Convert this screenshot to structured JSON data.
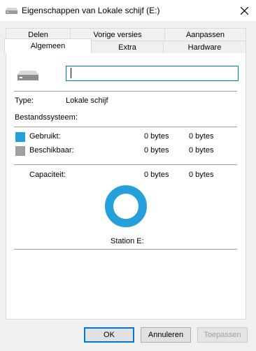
{
  "window": {
    "title": "Eigenschappen van Lokale schijf (E:)"
  },
  "tabs": {
    "row1": [
      {
        "label": "Delen",
        "name": "tab-delen"
      },
      {
        "label": "Vorige versies",
        "name": "tab-vorige-versies"
      },
      {
        "label": "Aanpassen",
        "name": "tab-aanpassen"
      }
    ],
    "row2": [
      {
        "label": "Algemeen",
        "name": "tab-algemeen",
        "active": true
      },
      {
        "label": "Extra",
        "name": "tab-extra"
      },
      {
        "label": "Hardware",
        "name": "tab-hardware"
      }
    ]
  },
  "general": {
    "name_value": "",
    "type_label": "Type:",
    "type_value": "Lokale schijf",
    "filesystem_label": "Bestandssysteem:",
    "filesystem_value": "",
    "used": {
      "label": "Gebruikt:",
      "bytes": "0 bytes",
      "size": "0 bytes",
      "color": "#26a0da"
    },
    "free": {
      "label": "Beschikbaar:",
      "bytes": "0 bytes",
      "size": "0 bytes",
      "color": "#a0a0a0"
    },
    "capacity": {
      "label": "Capaciteit:",
      "bytes": "0 bytes",
      "size": "0 bytes"
    },
    "chart_color": "#26a0da",
    "drive_caption": "Station E:"
  },
  "buttons": {
    "ok": "OK",
    "cancel": "Annuleren",
    "apply": "Toepassen"
  },
  "icons": {
    "title": "drive-icon",
    "close": "close-icon",
    "drive": "drive-icon"
  }
}
